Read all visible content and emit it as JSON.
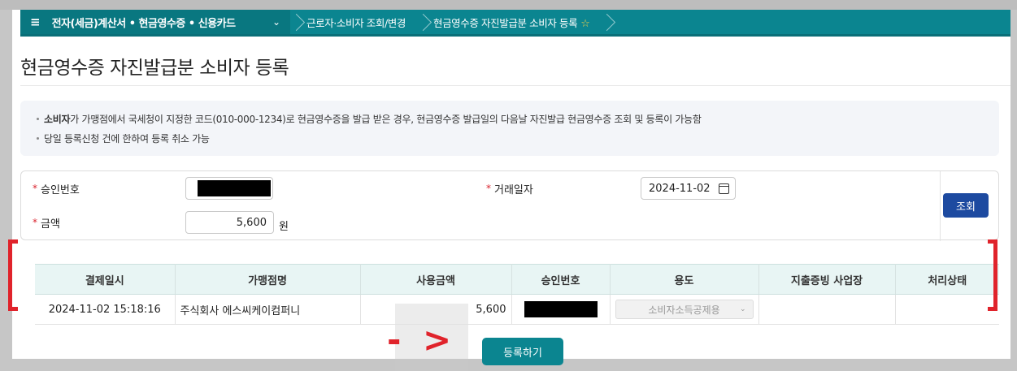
{
  "breadcrumb": {
    "menu_label": "전자(세금)계산서 • 현금영수증 • 신용카드",
    "item1": "근로자·소비자 조회/변경",
    "item2": "현금영수증 자진발급분 소비자 등록"
  },
  "page_title": "현금영수증 자진발급분 소비자 등록",
  "notice": {
    "line1_bold": "소비자",
    "line1_rest": "가 가맹점에서 국세청이 지정한 코드(010-000-1234)로 현금영수증을 발급 받은 경우, 현금영수증 발급일의 다음날 자진발급 현금영수증 조회 및 등록이 가능함",
    "line2": "당일 등록신청 건에 한하여 등록 취소 가능"
  },
  "form": {
    "approval_label": "승인번호",
    "date_label": "거래일자",
    "date_value": "2024-11-02",
    "amount_label": "금액",
    "amount_value": "5,600",
    "amount_unit": "원",
    "required_mark": "*",
    "search_button": "조회"
  },
  "table": {
    "headers": [
      "결제일시",
      "가맹점명",
      "사용금액",
      "승인번호",
      "용도",
      "지출증빙 사업장",
      "처리상태"
    ],
    "row": {
      "datetime": "2024-11-02 15:18:16",
      "merchant": "주식회사 에스씨케이컴퍼니",
      "amount": "5,600",
      "usage": "소비자소득공제용"
    }
  },
  "annotation_arrow": "- >",
  "register_button": "등록하기"
}
